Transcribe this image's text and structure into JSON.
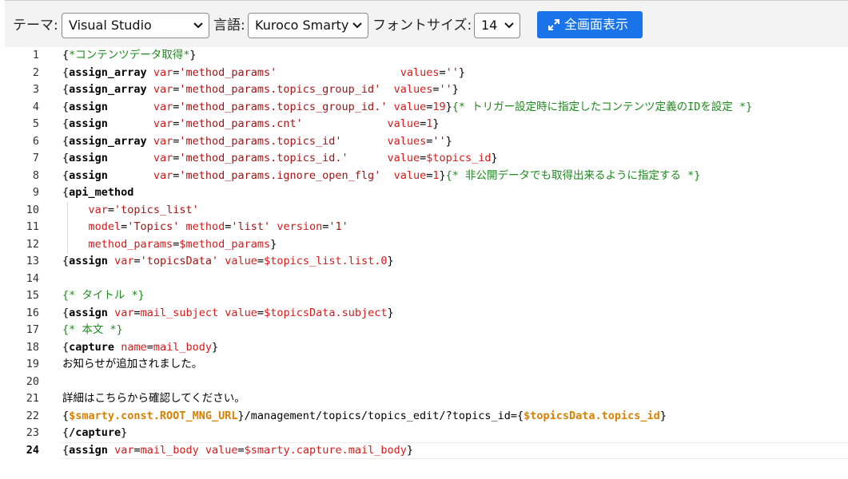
{
  "toolbar": {
    "theme_label": "テーマ:",
    "theme_value": "Visual Studio",
    "lang_label": "言語:",
    "lang_value": "Kuroco Smarty",
    "font_label": "フォントサイズ:",
    "font_value": "14",
    "fullscreen_label": "全画面表示"
  },
  "editor": {
    "active_line": 24,
    "lines": [
      {
        "n": "1",
        "tokens": [
          [
            "b",
            "{"
          ],
          [
            "c",
            "*コンテンツデータ取得*"
          ],
          [
            "b",
            "}"
          ]
        ]
      },
      {
        "n": "2",
        "tokens": [
          [
            "b",
            "{"
          ],
          [
            "k",
            "assign_array"
          ],
          [
            "t",
            " "
          ],
          [
            "a",
            "var"
          ],
          [
            "t",
            "="
          ],
          [
            "s",
            "'method_params'"
          ],
          [
            "t",
            "                   "
          ],
          [
            "a",
            "values"
          ],
          [
            "t",
            "="
          ],
          [
            "s",
            "''"
          ],
          [
            "b",
            "}"
          ]
        ]
      },
      {
        "n": "3",
        "tokens": [
          [
            "b",
            "{"
          ],
          [
            "k",
            "assign_array"
          ],
          [
            "t",
            " "
          ],
          [
            "a",
            "var"
          ],
          [
            "t",
            "="
          ],
          [
            "s",
            "'method_params.topics_group_id'"
          ],
          [
            "t",
            "  "
          ],
          [
            "a",
            "values"
          ],
          [
            "t",
            "="
          ],
          [
            "s",
            "''"
          ],
          [
            "b",
            "}"
          ]
        ]
      },
      {
        "n": "4",
        "tokens": [
          [
            "b",
            "{"
          ],
          [
            "k",
            "assign"
          ],
          [
            "t",
            "       "
          ],
          [
            "a",
            "var"
          ],
          [
            "t",
            "="
          ],
          [
            "s",
            "'method_params.topics_group_id.'"
          ],
          [
            "t",
            " "
          ],
          [
            "a",
            "value"
          ],
          [
            "t",
            "="
          ],
          [
            "a",
            "19"
          ],
          [
            "b",
            "}"
          ],
          [
            "c",
            "{* トリガー設定時に指定したコンテンツ定義のIDを設定 *}"
          ]
        ]
      },
      {
        "n": "5",
        "tokens": [
          [
            "b",
            "{"
          ],
          [
            "k",
            "assign"
          ],
          [
            "t",
            "       "
          ],
          [
            "a",
            "var"
          ],
          [
            "t",
            "="
          ],
          [
            "s",
            "'method_params.cnt'"
          ],
          [
            "t",
            "             "
          ],
          [
            "a",
            "value"
          ],
          [
            "t",
            "="
          ],
          [
            "a",
            "1"
          ],
          [
            "b",
            "}"
          ]
        ]
      },
      {
        "n": "6",
        "tokens": [
          [
            "b",
            "{"
          ],
          [
            "k",
            "assign_array"
          ],
          [
            "t",
            " "
          ],
          [
            "a",
            "var"
          ],
          [
            "t",
            "="
          ],
          [
            "s",
            "'method_params.topics_id'"
          ],
          [
            "t",
            "       "
          ],
          [
            "a",
            "values"
          ],
          [
            "t",
            "="
          ],
          [
            "s",
            "''"
          ],
          [
            "b",
            "}"
          ]
        ]
      },
      {
        "n": "7",
        "tokens": [
          [
            "b",
            "{"
          ],
          [
            "k",
            "assign"
          ],
          [
            "t",
            "       "
          ],
          [
            "a",
            "var"
          ],
          [
            "t",
            "="
          ],
          [
            "s",
            "'method_params.topics_id.'"
          ],
          [
            "t",
            "      "
          ],
          [
            "a",
            "value"
          ],
          [
            "t",
            "="
          ],
          [
            "v",
            "$topics_id"
          ],
          [
            "b",
            "}"
          ]
        ]
      },
      {
        "n": "8",
        "tokens": [
          [
            "b",
            "{"
          ],
          [
            "k",
            "assign"
          ],
          [
            "t",
            "       "
          ],
          [
            "a",
            "var"
          ],
          [
            "t",
            "="
          ],
          [
            "s",
            "'method_params.ignore_open_flg'"
          ],
          [
            "t",
            "  "
          ],
          [
            "a",
            "value"
          ],
          [
            "t",
            "="
          ],
          [
            "a",
            "1"
          ],
          [
            "b",
            "}"
          ],
          [
            "c",
            "{* 非公開データでも取得出来るように指定する *}"
          ]
        ]
      },
      {
        "n": "9",
        "tokens": [
          [
            "b",
            "{"
          ],
          [
            "k",
            "api_method"
          ]
        ]
      },
      {
        "n": "10",
        "tokens": [
          [
            "t",
            "    "
          ],
          [
            "a",
            "var"
          ],
          [
            "t",
            "="
          ],
          [
            "s",
            "'topics_list'"
          ]
        ]
      },
      {
        "n": "11",
        "tokens": [
          [
            "t",
            "    "
          ],
          [
            "a",
            "model"
          ],
          [
            "t",
            "="
          ],
          [
            "s",
            "'Topics'"
          ],
          [
            "t",
            " "
          ],
          [
            "a",
            "method"
          ],
          [
            "t",
            "="
          ],
          [
            "s",
            "'list'"
          ],
          [
            "t",
            " "
          ],
          [
            "a",
            "version"
          ],
          [
            "t",
            "="
          ],
          [
            "s",
            "'1'"
          ]
        ]
      },
      {
        "n": "12",
        "tokens": [
          [
            "t",
            "    "
          ],
          [
            "a",
            "method_params"
          ],
          [
            "t",
            "="
          ],
          [
            "v",
            "$method_params"
          ],
          [
            "b",
            "}"
          ]
        ]
      },
      {
        "n": "13",
        "tokens": [
          [
            "b",
            "{"
          ],
          [
            "k",
            "assign"
          ],
          [
            "t",
            " "
          ],
          [
            "a",
            "var"
          ],
          [
            "t",
            "="
          ],
          [
            "s",
            "'topicsData'"
          ],
          [
            "t",
            " "
          ],
          [
            "a",
            "value"
          ],
          [
            "t",
            "="
          ],
          [
            "v",
            "$topics_list.list.0"
          ],
          [
            "b",
            "}"
          ]
        ]
      },
      {
        "n": "14",
        "tokens": []
      },
      {
        "n": "15",
        "tokens": [
          [
            "c",
            "{* タイトル *}"
          ]
        ]
      },
      {
        "n": "16",
        "tokens": [
          [
            "b",
            "{"
          ],
          [
            "k",
            "assign"
          ],
          [
            "t",
            " "
          ],
          [
            "a",
            "var"
          ],
          [
            "t",
            "="
          ],
          [
            "a",
            "mail_subject"
          ],
          [
            "t",
            " "
          ],
          [
            "a",
            "value"
          ],
          [
            "t",
            "="
          ],
          [
            "v",
            "$topicsData.subject"
          ],
          [
            "b",
            "}"
          ]
        ]
      },
      {
        "n": "17",
        "tokens": [
          [
            "c",
            "{* 本文 *}"
          ]
        ]
      },
      {
        "n": "18",
        "tokens": [
          [
            "b",
            "{"
          ],
          [
            "k",
            "capture"
          ],
          [
            "t",
            " "
          ],
          [
            "a",
            "name"
          ],
          [
            "t",
            "="
          ],
          [
            "a",
            "mail_body"
          ],
          [
            "b",
            "}"
          ]
        ]
      },
      {
        "n": "19",
        "tokens": [
          [
            "j",
            "お知らせが追加されました。"
          ]
        ]
      },
      {
        "n": "20",
        "tokens": []
      },
      {
        "n": "21",
        "tokens": [
          [
            "j",
            "詳細はこちらから確認してください。"
          ]
        ]
      },
      {
        "n": "22",
        "tokens": [
          [
            "b",
            "{"
          ],
          [
            "o",
            "$smarty.const.ROOT_MNG_URL"
          ],
          [
            "b",
            "}"
          ],
          [
            "t",
            "/management/topics/topics_edit/?topics_id="
          ],
          [
            "b",
            "{"
          ],
          [
            "o",
            "$topicsData.topics_id"
          ],
          [
            "b",
            "}"
          ]
        ]
      },
      {
        "n": "23",
        "tokens": [
          [
            "b",
            "{"
          ],
          [
            "k",
            "/capture"
          ],
          [
            "b",
            "}"
          ]
        ]
      },
      {
        "n": "24",
        "tokens": [
          [
            "b",
            "{"
          ],
          [
            "k",
            "assign"
          ],
          [
            "t",
            " "
          ],
          [
            "a",
            "var"
          ],
          [
            "t",
            "="
          ],
          [
            "a",
            "mail_body"
          ],
          [
            "t",
            " "
          ],
          [
            "a",
            "value"
          ],
          [
            "t",
            "="
          ],
          [
            "v",
            "$smarty.capture.mail_body"
          ],
          [
            "b",
            "}"
          ]
        ]
      }
    ]
  }
}
